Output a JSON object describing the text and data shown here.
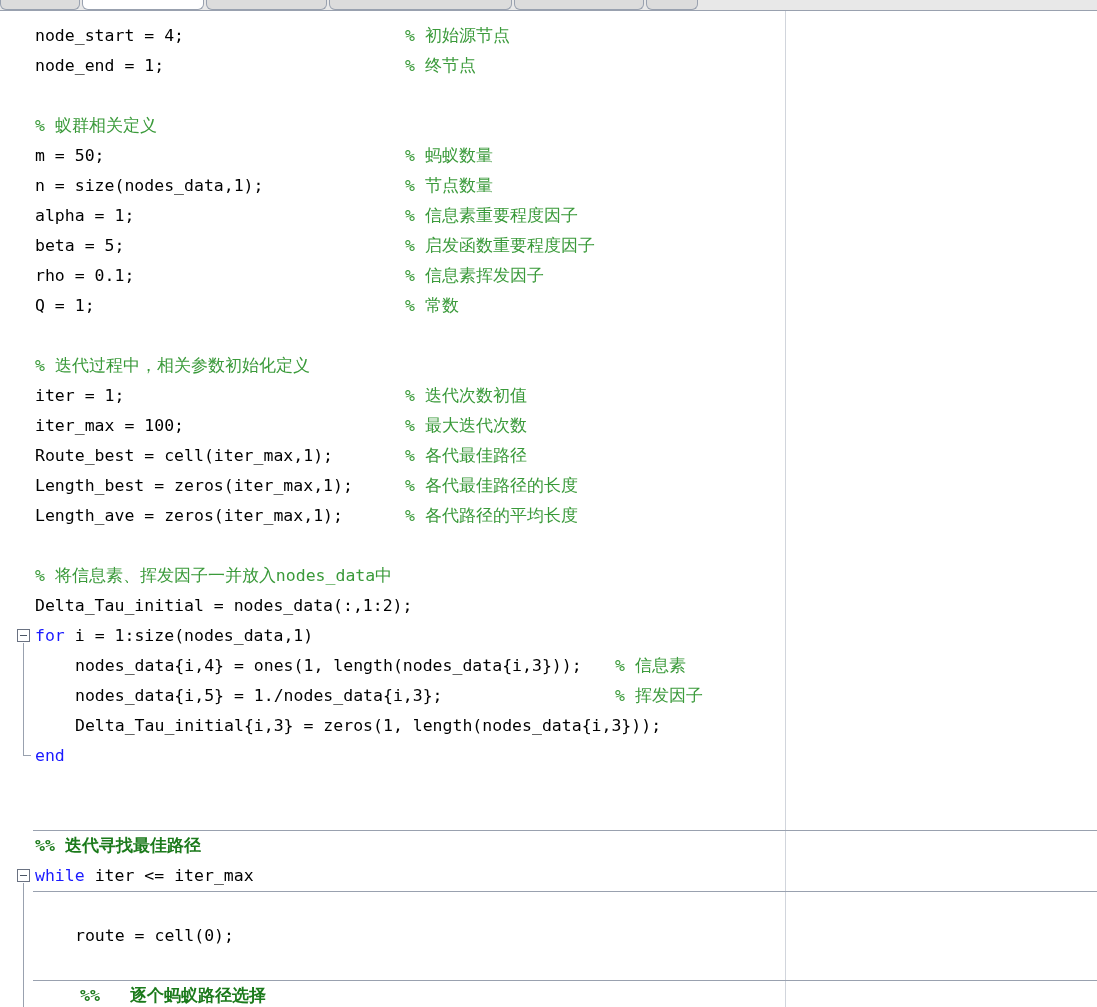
{
  "tabs": [
    {
      "selected": false
    },
    {
      "selected": true
    },
    {
      "selected": false
    },
    {
      "selected": false
    },
    {
      "selected": false
    },
    {
      "selected": false
    }
  ],
  "lines": [
    {
      "kind": "code",
      "code": "node_start = 4;",
      "comment": "% 初始源节点"
    },
    {
      "kind": "code",
      "code": "node_end = 1;",
      "comment": "% 终节点"
    },
    {
      "kind": "blank"
    },
    {
      "kind": "comment",
      "comment": "% 蚁群相关定义"
    },
    {
      "kind": "code",
      "code": "m = 50;",
      "comment": "% 蚂蚁数量"
    },
    {
      "kind": "code",
      "code": "n = size(nodes_data,1);",
      "comment": "% 节点数量"
    },
    {
      "kind": "code",
      "code": "alpha = 1;",
      "comment": "% 信息素重要程度因子"
    },
    {
      "kind": "code",
      "code": "beta = 5;",
      "comment": "% 启发函数重要程度因子"
    },
    {
      "kind": "code",
      "code": "rho = 0.1;",
      "comment": "% 信息素挥发因子"
    },
    {
      "kind": "code",
      "code": "Q = 1;",
      "comment": "% 常数"
    },
    {
      "kind": "blank"
    },
    {
      "kind": "comment",
      "comment": "% 迭代过程中，相关参数初始化定义"
    },
    {
      "kind": "code",
      "code": "iter = 1;",
      "comment": "% 迭代次数初值"
    },
    {
      "kind": "code",
      "code": "iter_max = 100;",
      "comment": "% 最大迭代次数"
    },
    {
      "kind": "code",
      "code": "Route_best = cell(iter_max,1);",
      "comment": "% 各代最佳路径"
    },
    {
      "kind": "code",
      "code": "Length_best = zeros(iter_max,1);",
      "comment": "% 各代最佳路径的长度"
    },
    {
      "kind": "code",
      "code": "Length_ave = zeros(iter_max,1);",
      "comment": "% 各代路径的平均长度"
    },
    {
      "kind": "blank"
    },
    {
      "kind": "comment",
      "comment": "% 将信息素、挥发因子一并放入nodes_data中"
    },
    {
      "kind": "code",
      "code": "Delta_Tau_initial = nodes_data(:,1:2);"
    },
    {
      "kind": "block",
      "keyword": "for",
      "head": "i = 1:size(nodes_data,1)",
      "expanded": true,
      "closer": "end",
      "children": [
        {
          "kind": "code",
          "code": "nodes_data{i,4} = ones(1, length(nodes_data{i,3}));",
          "comment": "% 信息素"
        },
        {
          "kind": "code",
          "code": "nodes_data{i,5} = 1./nodes_data{i,3};",
          "comment": "% 挥发因子"
        },
        {
          "kind": "code",
          "code": "Delta_Tau_initial{i,3} = zeros(1, length(nodes_data{i,3}));"
        }
      ]
    },
    {
      "kind": "blank"
    },
    {
      "kind": "blank"
    },
    {
      "kind": "section",
      "title": "%% 迭代寻找最佳路径"
    },
    {
      "kind": "block",
      "keyword": "while",
      "head": "iter <= iter_max",
      "expanded": true,
      "children": [
        {
          "kind": "break"
        },
        {
          "kind": "blank"
        },
        {
          "kind": "code",
          "code": "route = cell(0);"
        },
        {
          "kind": "blank"
        },
        {
          "kind": "section",
          "title": "%%   逐个蚂蚁路径选择"
        }
      ]
    }
  ]
}
